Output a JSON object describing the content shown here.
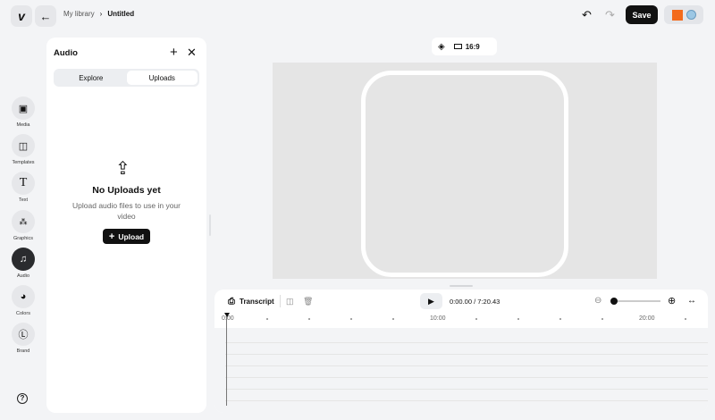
{
  "header": {
    "breadcrumb": [
      "My library",
      "Untitled"
    ],
    "save_label": "Save"
  },
  "sidebar": {
    "items": [
      {
        "label": "Media",
        "icon": "image-icon"
      },
      {
        "label": "Templates",
        "icon": "layout-icon"
      },
      {
        "label": "Text",
        "icon": "text-icon"
      },
      {
        "label": "Graphics",
        "icon": "shapes-icon"
      },
      {
        "label": "Audio",
        "icon": "music-icon",
        "active": true
      },
      {
        "label": "Colors",
        "icon": "palette-icon"
      },
      {
        "label": "Brand",
        "icon": "brand-icon"
      }
    ]
  },
  "panel": {
    "title": "Audio",
    "tabs": [
      "Explore",
      "Uploads"
    ],
    "active_tab": "Uploads",
    "empty_title": "No Uploads yet",
    "empty_text": "Upload audio files to use in your video",
    "upload_label": "Upload"
  },
  "canvas": {
    "aspect": "16:9"
  },
  "timeline": {
    "transcript_label": "Transcript",
    "time": "0:00.00 / 7:20.43",
    "zoom_level": 0,
    "labels": [
      "0:00",
      "10:00",
      "20:00"
    ]
  },
  "colors": {
    "accent": "#111111",
    "playhead": "#e05a4f"
  }
}
